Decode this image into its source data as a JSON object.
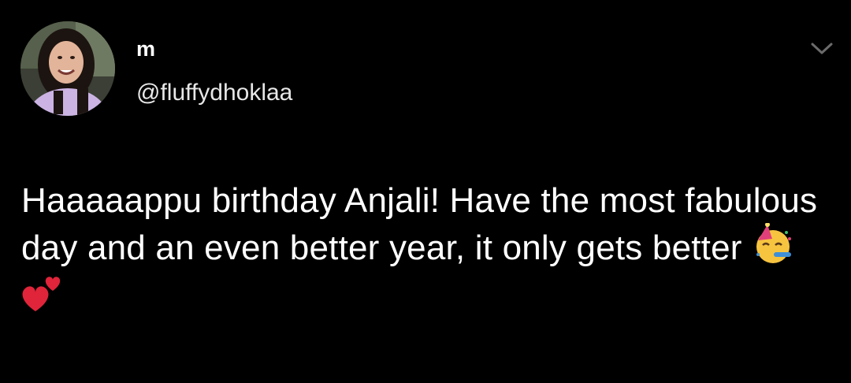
{
  "tweet": {
    "author": {
      "display_name": "m",
      "handle": "@fluffydhoklaa",
      "avatar_icon": "profile-photo"
    },
    "menu_icon": "chevron-down-icon",
    "text": "Haaaaappu birthday Anjali! Have the most fabulous day and an even better year, it only gets better",
    "emojis": [
      "partying-face-emoji",
      "two-hearts-emoji"
    ]
  },
  "colors": {
    "background": "#000000",
    "text_primary": "#ffffff",
    "text_secondary": "#e7e7e7",
    "chevron": "#6b6b6b"
  }
}
